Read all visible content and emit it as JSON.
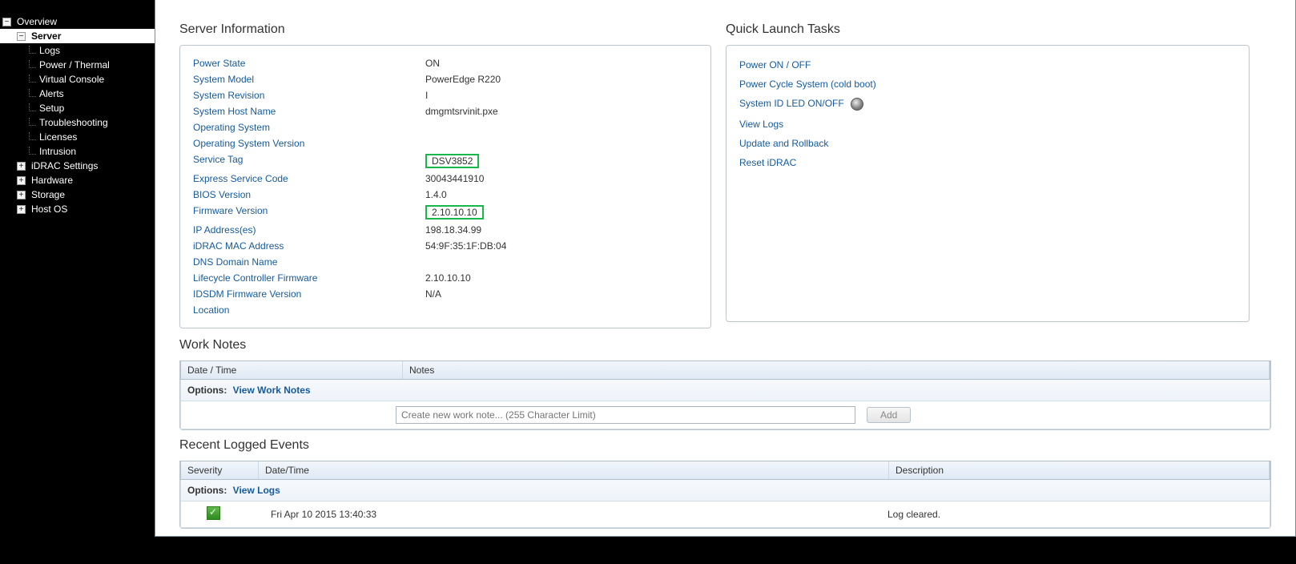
{
  "sidebar": {
    "items": [
      {
        "label": "Overview",
        "depth": 0,
        "expander": "−",
        "selected": false
      },
      {
        "label": "Server",
        "depth": 1,
        "expander": "−",
        "selected": true
      },
      {
        "label": "Logs",
        "depth": 2,
        "expander": null,
        "selected": false
      },
      {
        "label": "Power / Thermal",
        "depth": 2,
        "expander": null,
        "selected": false
      },
      {
        "label": "Virtual Console",
        "depth": 2,
        "expander": null,
        "selected": false
      },
      {
        "label": "Alerts",
        "depth": 2,
        "expander": null,
        "selected": false
      },
      {
        "label": "Setup",
        "depth": 2,
        "expander": null,
        "selected": false
      },
      {
        "label": "Troubleshooting",
        "depth": 2,
        "expander": null,
        "selected": false
      },
      {
        "label": "Licenses",
        "depth": 2,
        "expander": null,
        "selected": false
      },
      {
        "label": "Intrusion",
        "depth": 2,
        "expander": null,
        "selected": false
      },
      {
        "label": "iDRAC Settings",
        "depth": 1,
        "expander": "+",
        "selected": false
      },
      {
        "label": "Hardware",
        "depth": 1,
        "expander": "+",
        "selected": false
      },
      {
        "label": "Storage",
        "depth": 1,
        "expander": "+",
        "selected": false
      },
      {
        "label": "Host OS",
        "depth": 1,
        "expander": "+",
        "selected": false
      }
    ]
  },
  "server_info": {
    "title": "Server Information",
    "rows": [
      {
        "label": "Power State",
        "value": "ON",
        "highlight": false
      },
      {
        "label": "System Model",
        "value": "PowerEdge R220",
        "highlight": false
      },
      {
        "label": "System Revision",
        "value": "I",
        "highlight": false
      },
      {
        "label": "System Host Name",
        "value": "dmgmtsrvinit.pxe",
        "highlight": false
      },
      {
        "label": "Operating System",
        "value": "",
        "highlight": false
      },
      {
        "label": "Operating System Version",
        "value": "",
        "highlight": false
      },
      {
        "label": "Service Tag",
        "value": "DSV3852",
        "highlight": true
      },
      {
        "label": "Express Service Code",
        "value": "30043441910",
        "highlight": false
      },
      {
        "label": "BIOS Version",
        "value": "1.4.0",
        "highlight": false
      },
      {
        "label": "Firmware Version",
        "value": "2.10.10.10",
        "highlight": true
      },
      {
        "label": "IP Address(es)",
        "value": "198.18.34.99",
        "highlight": false
      },
      {
        "label": "iDRAC MAC Address",
        "value": "54:9F:35:1F:DB:04",
        "highlight": false
      },
      {
        "label": "DNS Domain Name",
        "value": "",
        "highlight": false
      },
      {
        "label": "Lifecycle Controller Firmware",
        "value": "2.10.10.10",
        "highlight": false
      },
      {
        "label": "IDSDM Firmware Version",
        "value": "N/A",
        "highlight": false
      },
      {
        "label": "Location",
        "value": "",
        "highlight": false
      }
    ]
  },
  "quick_launch": {
    "title": "Quick Launch Tasks",
    "items": [
      {
        "label": "Power ON / OFF",
        "led": false
      },
      {
        "label": "Power Cycle System (cold boot)",
        "led": false
      },
      {
        "label": "System ID LED ON/OFF",
        "led": true
      },
      {
        "label": "View Logs",
        "led": false
      },
      {
        "label": "Update and Rollback",
        "led": false
      },
      {
        "label": "Reset iDRAC",
        "led": false
      }
    ]
  },
  "work_notes": {
    "title": "Work Notes",
    "headers": {
      "date_time": "Date / Time",
      "notes": "Notes"
    },
    "options_label": "Options:",
    "view_link": "View Work Notes",
    "input_placeholder": "Create new work note... (255 Character Limit)",
    "add_label": "Add"
  },
  "recent_events": {
    "title": "Recent Logged Events",
    "headers": {
      "severity": "Severity",
      "date_time": "Date/Time",
      "description": "Description"
    },
    "options_label": "Options:",
    "view_link": "View Logs",
    "rows": [
      {
        "severity_icon": "check",
        "date_time": "Fri Apr 10 2015 13:40:33",
        "description": "Log cleared."
      }
    ]
  }
}
